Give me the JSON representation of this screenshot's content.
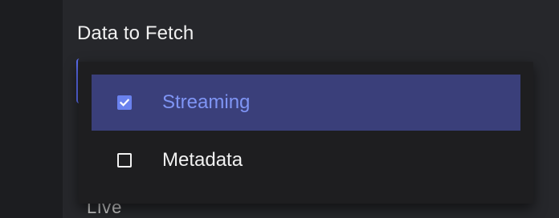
{
  "field": {
    "title": "Data to Fetch"
  },
  "behind_field": {
    "label": "Live"
  },
  "dropdown": {
    "options": [
      {
        "label": "Streaming",
        "checked": true,
        "icon": "checkbox-checked-icon"
      },
      {
        "label": "Metadata",
        "checked": false,
        "icon": "checkbox-unchecked-icon"
      }
    ]
  },
  "colors": {
    "selected_row": "#3a3f7a",
    "accent": "#6a82ee",
    "selected_text": "#7f95f5",
    "menu_bg": "#1e1e20"
  }
}
